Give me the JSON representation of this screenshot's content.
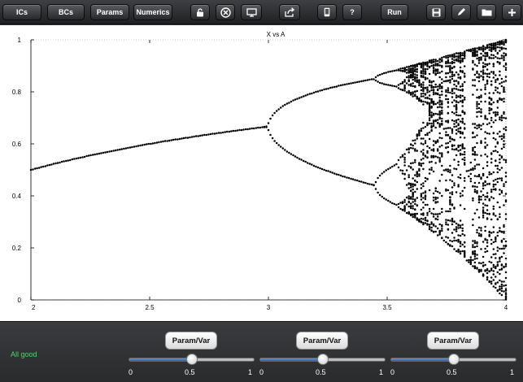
{
  "toolbar": {
    "ics_label": "ICs",
    "bcs_label": "BCs",
    "params_label": "Params",
    "numerics_label": "Numerics",
    "run_label": "Run",
    "help_label": "?",
    "icons": [
      "lock-icon",
      "close-circle-icon",
      "monitor-icon",
      "share-icon",
      "device-icon",
      "save-icon",
      "edit-icon",
      "folder-icon",
      "add-icon"
    ]
  },
  "chart_data": {
    "type": "scatter",
    "title": "X vs A",
    "xlabel": "",
    "ylabel": "",
    "xlim": [
      2,
      4
    ],
    "ylim": [
      0,
      1
    ],
    "x_ticks": [
      "2",
      "2.5",
      "3",
      "3.5",
      "4"
    ],
    "y_ticks": [
      "0",
      "0.2",
      "0.4",
      "0.6",
      "0.8",
      "1"
    ],
    "grid": false,
    "series": [
      {
        "description_of_values": "logistic map attractor x = A*x*(1-x)",
        "a_start": 2.0,
        "a_end": 4.0,
        "sample_points": [
          {
            "x": 2.0,
            "y": 0.5
          },
          {
            "x": 2.5,
            "y": 0.6
          },
          {
            "x": 3.0,
            "y": 0.667
          },
          {
            "x": 3.2,
            "y": 0.8
          },
          {
            "x": 3.2,
            "y": 0.51
          },
          {
            "x": 3.44,
            "y": 0.85
          },
          {
            "x": 3.44,
            "y": 0.44
          },
          {
            "x": 4.0,
            "y": 1.0
          },
          {
            "x": 4.0,
            "y": 0.0
          }
        ]
      }
    ],
    "point_color": "#000000"
  },
  "controls": {
    "status_text": "All good",
    "status_color": "#4cd964",
    "sliders": [
      {
        "button_label": "Param/Var",
        "min_label": "0",
        "mid_label": "0.5",
        "max_label": "1",
        "value": 0.5
      },
      {
        "button_label": "Param/Var",
        "min_label": "0",
        "mid_label": "0.5",
        "max_label": "1",
        "value": 0.5
      },
      {
        "button_label": "Param/Var",
        "min_label": "0",
        "mid_label": "0.5",
        "max_label": "1",
        "value": 0.5
      }
    ],
    "accent_color": "#2d5fae"
  }
}
